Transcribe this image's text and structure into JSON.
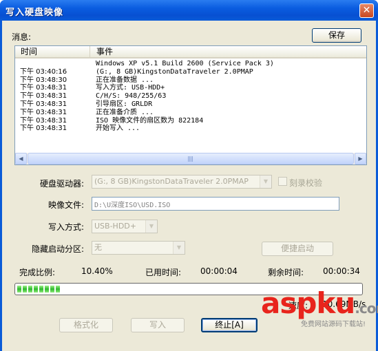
{
  "window": {
    "title": "写入硬盘映像",
    "close_glyph": "✕"
  },
  "message": {
    "label": "消息:",
    "save_button": "保存"
  },
  "log": {
    "columns": [
      "时间",
      "事件"
    ],
    "rows": [
      {
        "time": "",
        "event": "Windows XP v5.1 Build 2600 (Service Pack 3)"
      },
      {
        "time": "下午 03:40:16",
        "event": "(G:, 8 GB)KingstonDataTraveler 2.0PMAP"
      },
      {
        "time": "下午 03:48:30",
        "event": "正在准备数据 ..."
      },
      {
        "time": "下午 03:48:31",
        "event": "写入方式: USB-HDD+"
      },
      {
        "time": "下午 03:48:31",
        "event": "C/H/S: 948/255/63"
      },
      {
        "time": "下午 03:48:31",
        "event": "引导扇区: GRLDR"
      },
      {
        "time": "下午 03:48:31",
        "event": "正在准备介质 ..."
      },
      {
        "time": "下午 03:48:31",
        "event": "ISO 映像文件的扇区数为 822184"
      },
      {
        "time": "下午 03:48:31",
        "event": "开始写入 ..."
      }
    ],
    "scroll_left_icon": "scroll-left-icon",
    "scroll_right_icon": "scroll-right-icon"
  },
  "form": {
    "drive_label": "硬盘驱动器:",
    "drive_value": "(G:, 8 GB)KingstonDataTraveler 2.0PMAP",
    "verify_label": "刻录校验",
    "image_label": "映像文件:",
    "image_value": "D:\\U深度ISO\\USD.ISO",
    "method_label": "写入方式:",
    "method_value": "USB-HDD+",
    "hidden_label": "隐藏启动分区:",
    "hidden_value": "无",
    "quick_boot_button": "便捷启动"
  },
  "progress": {
    "percent_label": "完成比例:",
    "percent_value": "10.40%",
    "elapsed_label": "已用时间:",
    "elapsed_value": "00:00:04",
    "remaining_label": "剩余时间:",
    "remaining_value": "00:00:34",
    "fraction": 0.104,
    "speed_label": "速度:",
    "speed_value": "10.69MB/s"
  },
  "buttons": {
    "format": "格式化",
    "write": "写入",
    "stop": "终止[A]"
  },
  "watermark": {
    "logo_a": "asp",
    "logo_b": "ku",
    "logo_c": ".com",
    "sub": "免费网站源码下载站!"
  },
  "colors": {
    "title_blue": "#0a5bd8",
    "dialog_bg": "#ece9d8",
    "progress_green": "#2db92d",
    "watermark_red": "#e8241c"
  }
}
